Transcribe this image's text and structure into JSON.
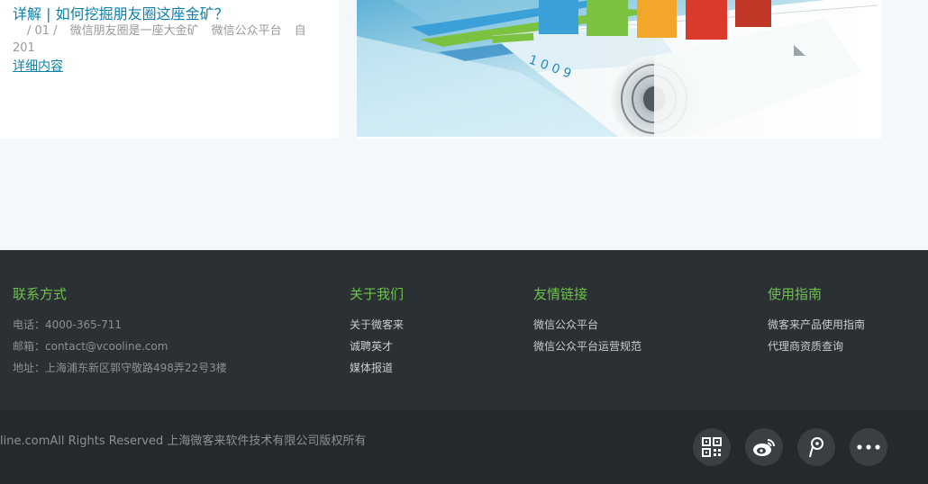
{
  "article": {
    "title": "详解 | 如何挖掘朋友圈这座金矿？",
    "number": "/ 01 /",
    "tags": [
      "微信朋友圈是一座大金矿",
      "微信公众平台"
    ],
    "source": "自201",
    "more_label": "详细内容"
  },
  "hero": {
    "icon": "report-chart-illustration",
    "bar_colors": [
      "#3ba0d8",
      "#7cc241",
      "#f2a72b",
      "#d93a2b"
    ]
  },
  "footer": {
    "contact": {
      "title": "联系方式",
      "phone": "电话：4000-365-711",
      "email": "邮箱：contact@vcooline.com",
      "address": "地址：上海浦东新区郭守敬路498弄22号3楼"
    },
    "about": {
      "title": "关于我们",
      "links": [
        "关于微客来",
        "诚聘英才",
        "媒体报道"
      ]
    },
    "friends": {
      "title": "友情链接",
      "links": [
        "微信公众平台",
        "微信公众平台运营规范"
      ]
    },
    "guide": {
      "title": "使用指南",
      "links": [
        "微客来产品使用指南",
        "代理商资质查询"
      ]
    },
    "copyright": "line.comAll Rights Reserved 上海微客来软件技术有限公司版权所有",
    "social_icons": [
      "qrcode-icon",
      "weibo-icon",
      "tencent-weibo-icon",
      "more-icon"
    ],
    "accent_color": "#6cc24a"
  }
}
